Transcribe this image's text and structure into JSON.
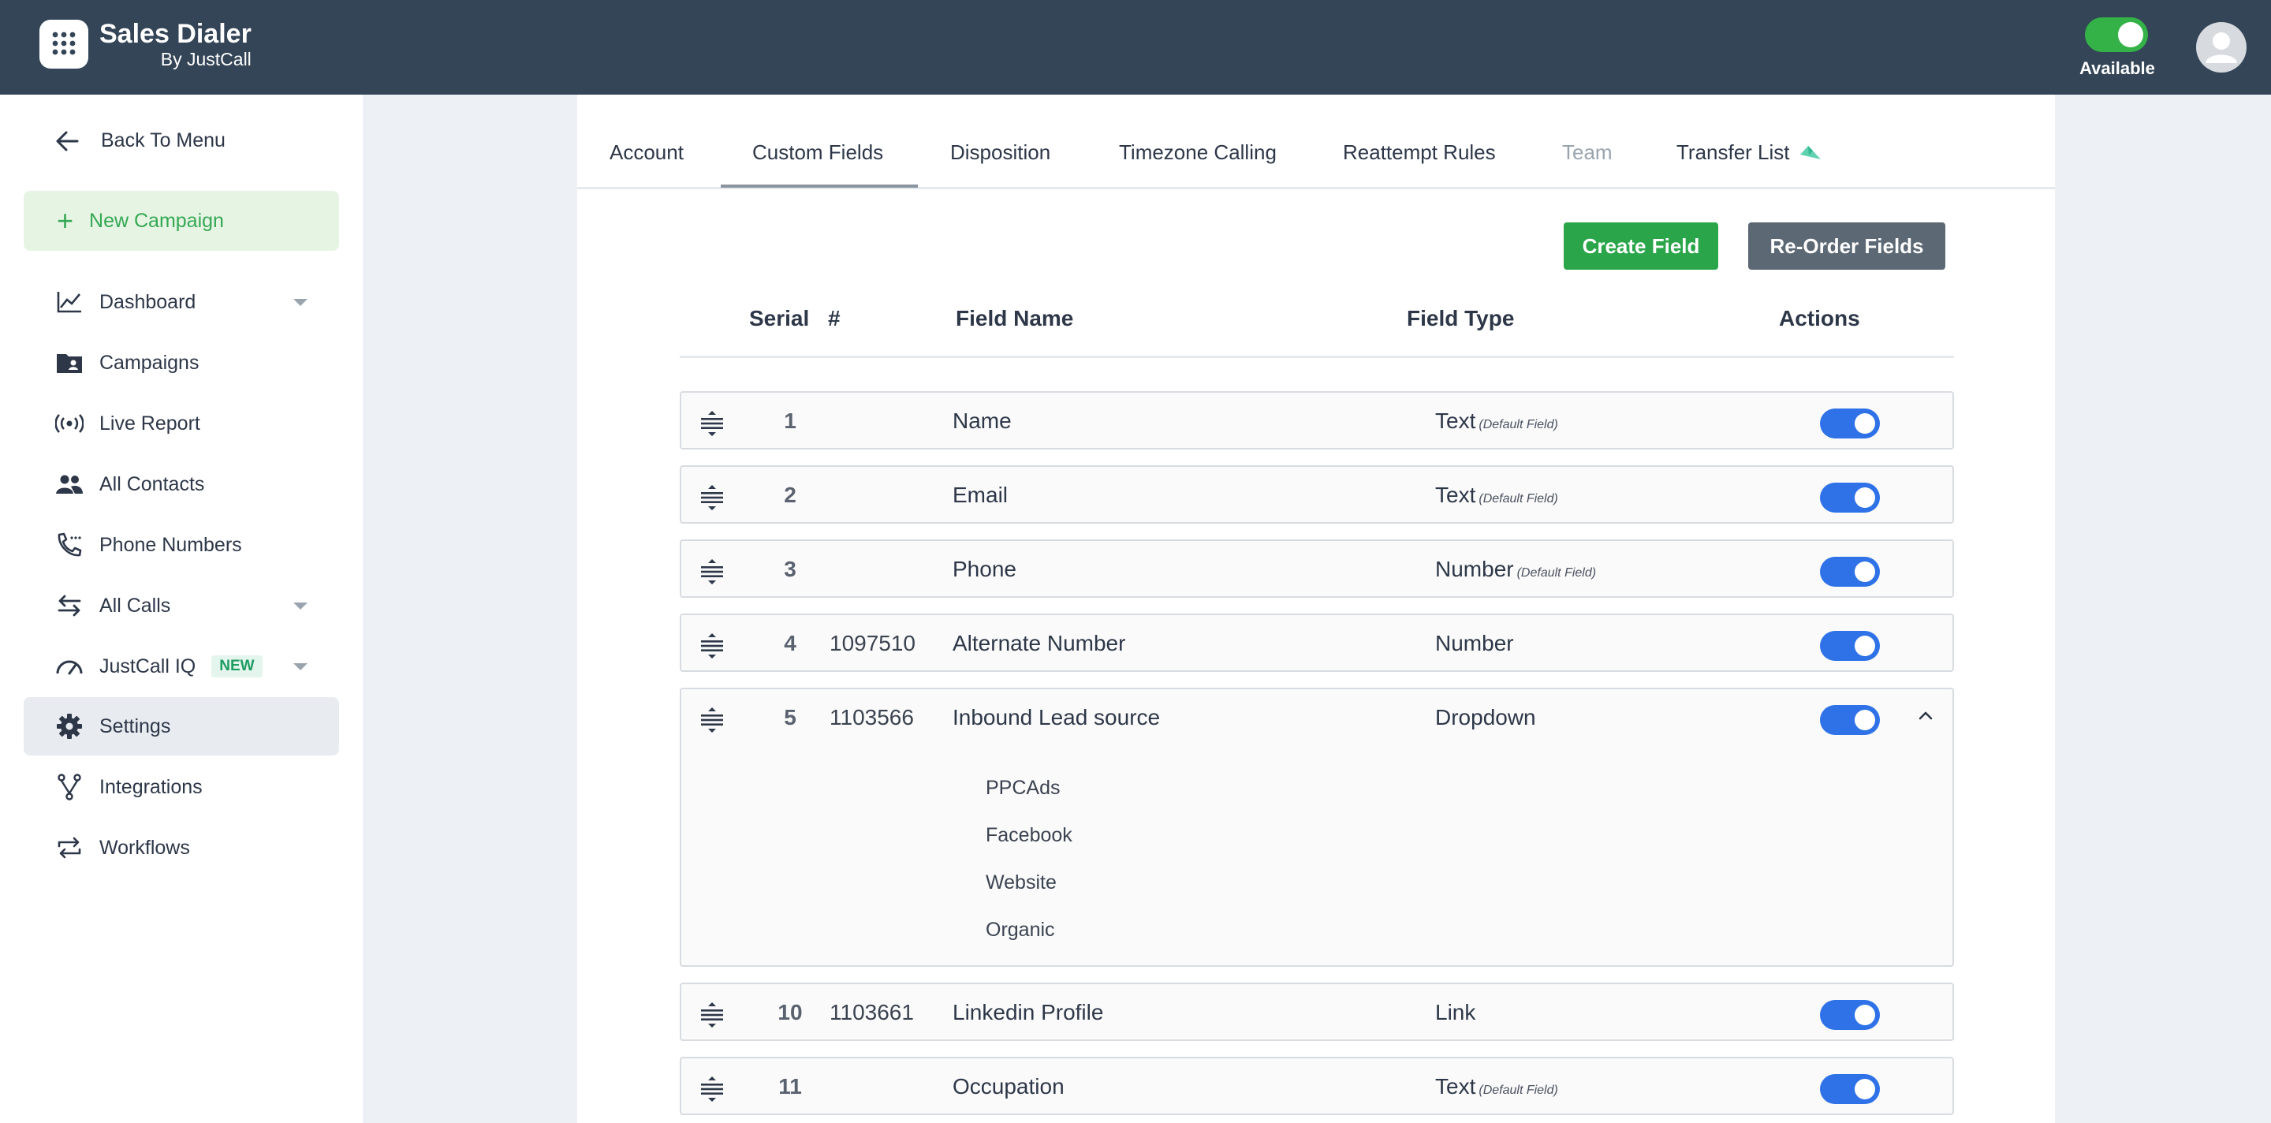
{
  "header": {
    "brand_title": "Sales Dialer",
    "brand_sub": "By JustCall",
    "status_label": "Available",
    "status_color": "#34b248"
  },
  "sidebar": {
    "back_label": "Back To Menu",
    "new_campaign_label": "New Campaign",
    "items": [
      {
        "label": "Dashboard",
        "icon": "chart-line-icon"
      },
      {
        "label": "Campaigns",
        "icon": "folder-user-icon"
      },
      {
        "label": "Live Report",
        "icon": "broadcast-icon"
      },
      {
        "label": "All Contacts",
        "icon": "people-icon"
      },
      {
        "label": "Phone Numbers",
        "icon": "phone-icon"
      },
      {
        "label": "All Calls",
        "icon": "arrows-swap-icon"
      },
      {
        "label": "JustCall IQ",
        "icon": "gauge-icon",
        "badge": "NEW"
      },
      {
        "label": "Settings",
        "icon": "gear-icon"
      },
      {
        "label": "Integrations",
        "icon": "fork-icon"
      },
      {
        "label": "Workflows",
        "icon": "repeat-icon"
      }
    ]
  },
  "tabs": [
    "Account",
    "Custom Fields",
    "Disposition",
    "Timezone Calling",
    "Reattempt Rules",
    "Team",
    "Transfer List"
  ],
  "active_tab": "Custom Fields",
  "actions": {
    "create_label": "Create Field",
    "reorder_label": "Re-Order Fields"
  },
  "table": {
    "headers": {
      "serial": "Serial",
      "id": "#",
      "name": "Field Name",
      "type": "Field Type",
      "actions": "Actions"
    },
    "default_tag": "(Default Field)",
    "rows": [
      {
        "serial": "1",
        "id": "",
        "name": "Name",
        "type": "Text",
        "default": true,
        "enabled": true
      },
      {
        "serial": "2",
        "id": "",
        "name": "Email",
        "type": "Text",
        "default": true,
        "enabled": true
      },
      {
        "serial": "3",
        "id": "",
        "name": "Phone",
        "type": "Number",
        "default": true,
        "enabled": true
      },
      {
        "serial": "4",
        "id": "1097510",
        "name": "Alternate Number",
        "type": "Number",
        "default": false,
        "enabled": true
      },
      {
        "serial": "5",
        "id": "1103566",
        "name": "Inbound Lead source",
        "type": "Dropdown",
        "default": false,
        "enabled": true,
        "options": [
          "PPCAds",
          "Facebook",
          "Website",
          "Organic"
        ]
      },
      {
        "serial": "10",
        "id": "1103661",
        "name": "Linkedin Profile",
        "type": "Link",
        "default": false,
        "enabled": true
      },
      {
        "serial": "11",
        "id": "",
        "name": "Occupation",
        "type": "Text",
        "default": true,
        "enabled": true
      }
    ]
  },
  "colors": {
    "topbar": "#344557",
    "toggle_on": "#2f72e8",
    "create_button": "#2aa54a",
    "reorder_button": "#5c6874",
    "new_campaign": "#34a853"
  }
}
